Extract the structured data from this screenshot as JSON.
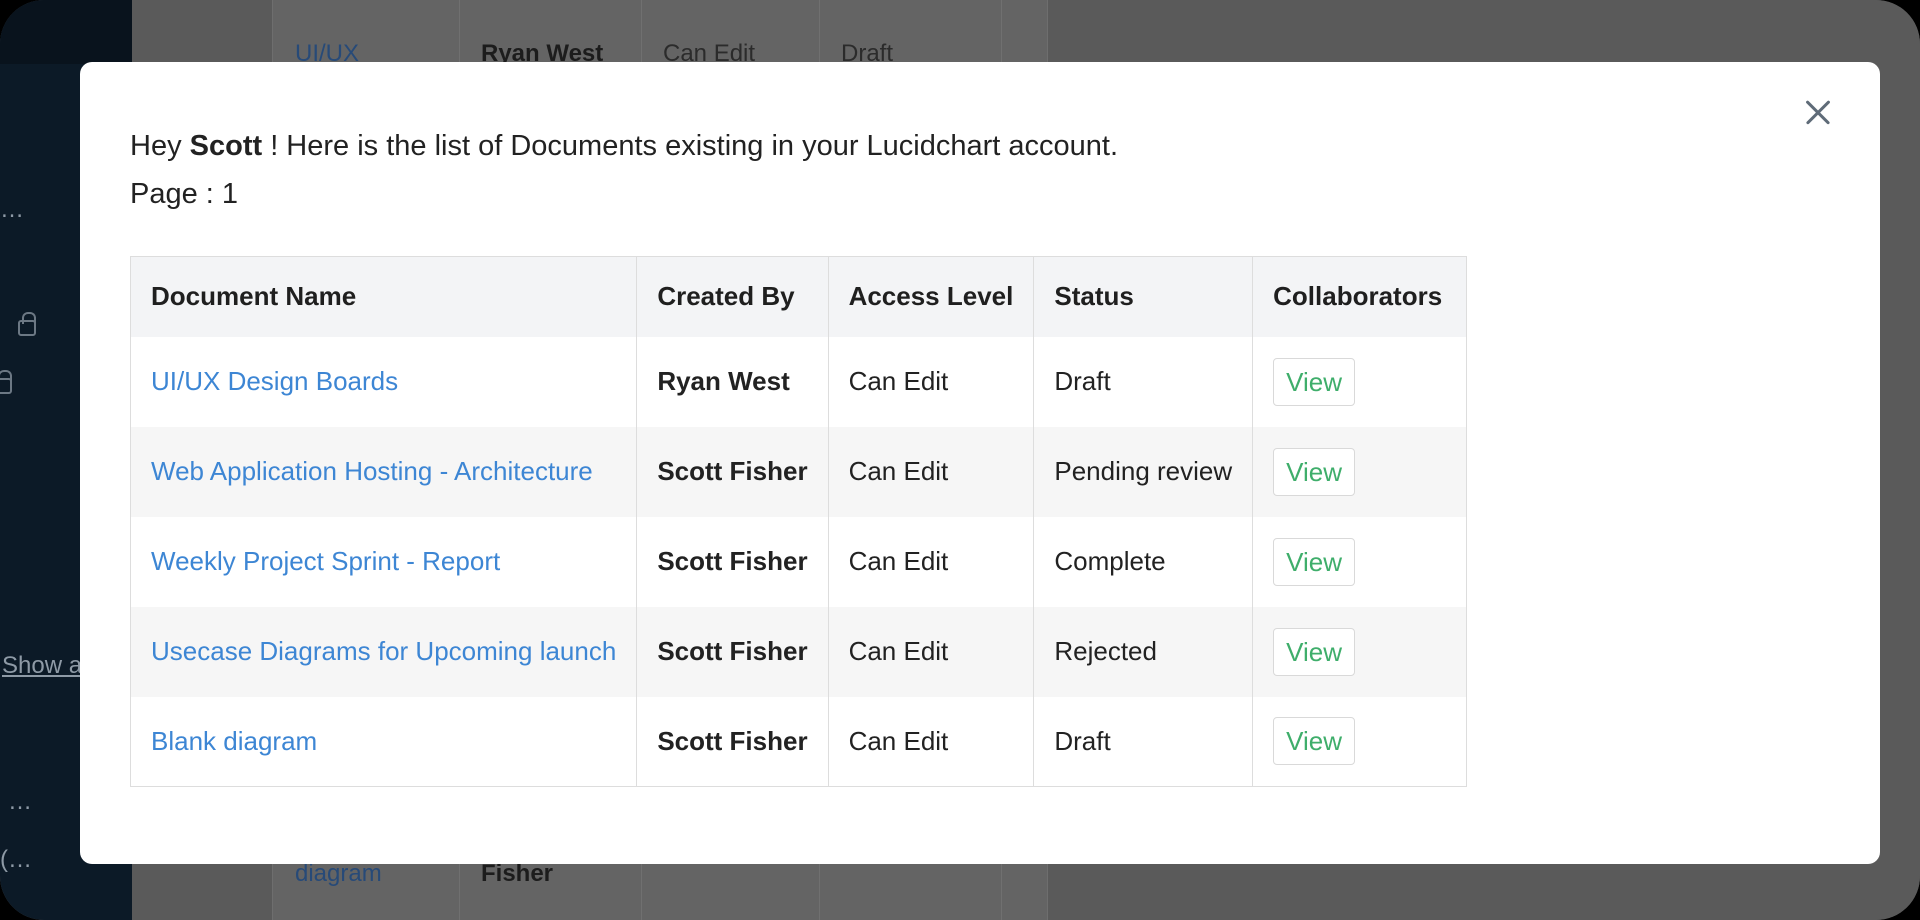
{
  "background": {
    "sidebar_fragments": [
      "…",
      "Show a",
      "…",
      "(…"
    ],
    "table_top_row": {
      "name": "UI/UX",
      "creator": "Ryan West",
      "access": "Can Edit",
      "status": "Draft"
    },
    "table_bottom_row": {
      "name": "diagram",
      "creator": "Fisher"
    }
  },
  "modal": {
    "greeting": {
      "prefix": "Hey ",
      "user": "Scott",
      "suffix": " ! Here is the list of Documents existing in your Lucidchart account."
    },
    "page_label": "Page : 1",
    "close_icon": "close-icon",
    "columns": [
      "Document Name",
      "Created By",
      "Access Level",
      "Status",
      "Collaborators"
    ],
    "rows": [
      {
        "name": "UI/UX Design Boards",
        "created_by": "Ryan West",
        "access": "Can Edit",
        "status": "Draft",
        "action": "View"
      },
      {
        "name": "Web Application Hosting - Architecture",
        "created_by": "Scott Fisher",
        "access": "Can Edit",
        "status": "Pending review",
        "action": "View"
      },
      {
        "name": "Weekly Project Sprint - Report",
        "created_by": "Scott Fisher",
        "access": "Can Edit",
        "status": "Complete",
        "action": "View"
      },
      {
        "name": "Usecase Diagrams for Upcoming launch",
        "created_by": "Scott Fisher",
        "access": "Can Edit",
        "status": "Rejected",
        "action": "View"
      },
      {
        "name": "Blank diagram",
        "created_by": "Scott Fisher",
        "access": "Can Edit",
        "status": "Draft",
        "action": "View"
      }
    ]
  },
  "colors": {
    "link": "#3d86d4",
    "view_button_text": "#3fae6b",
    "overlay": "#585858",
    "sidebar": "#0c1a27"
  }
}
